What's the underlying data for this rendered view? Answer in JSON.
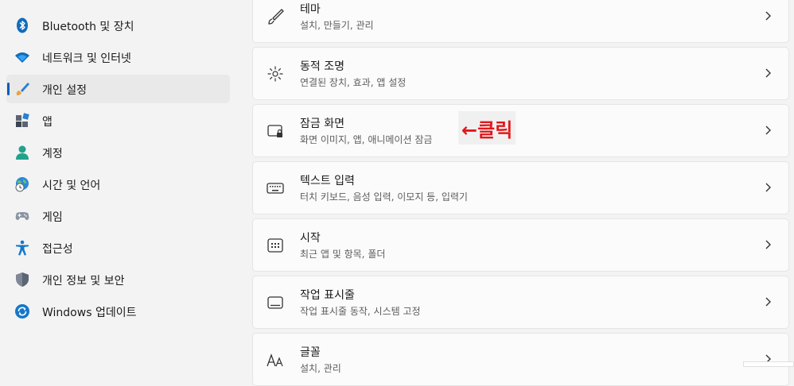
{
  "sidebar": {
    "items": [
      {
        "label": "Bluetooth 및 장치",
        "icon": "bluetooth-icon",
        "selected": false
      },
      {
        "label": "네트워크 및 인터넷",
        "icon": "wifi-icon",
        "selected": false
      },
      {
        "label": "개인 설정",
        "icon": "paintbrush-icon",
        "selected": true
      },
      {
        "label": "앱",
        "icon": "apps-icon",
        "selected": false
      },
      {
        "label": "계정",
        "icon": "person-icon",
        "selected": false
      },
      {
        "label": "시간 및 언어",
        "icon": "globe-clock-icon",
        "selected": false
      },
      {
        "label": "게임",
        "icon": "gamepad-icon",
        "selected": false
      },
      {
        "label": "접근성",
        "icon": "accessibility-icon",
        "selected": false
      },
      {
        "label": "개인 정보 및 보안",
        "icon": "shield-icon",
        "selected": false
      },
      {
        "label": "Windows 업데이트",
        "icon": "update-icon",
        "selected": false
      }
    ]
  },
  "main": {
    "cards": [
      {
        "title": "테마",
        "subtitle": "설치, 만들기, 관리",
        "icon": "theme-brush-icon"
      },
      {
        "title": "동적 조명",
        "subtitle": "연결된 장치, 효과, 앱 설정",
        "icon": "dynamic-lighting-icon"
      },
      {
        "title": "잠금 화면",
        "subtitle": "화면 이미지, 앱, 애니메이션 잠금",
        "icon": "lock-screen-icon"
      },
      {
        "title": "텍스트 입력",
        "subtitle": "터치 키보드, 음성 입력, 이모지 등, 입력기",
        "icon": "keyboard-icon"
      },
      {
        "title": "시작",
        "subtitle": "최근 앱 및 항목, 폴더",
        "icon": "start-icon"
      },
      {
        "title": "작업 표시줄",
        "subtitle": "작업 표시줄 동작, 시스템 고정",
        "icon": "taskbar-icon"
      },
      {
        "title": "글꼴",
        "subtitle": "설치, 관리",
        "icon": "fonts-icon"
      }
    ],
    "annotation": "←클릭"
  },
  "colors": {
    "accent": "#005fb8",
    "annotation": "#e0181b",
    "background": "#f3f3f3",
    "card": "#fbfbfb"
  }
}
